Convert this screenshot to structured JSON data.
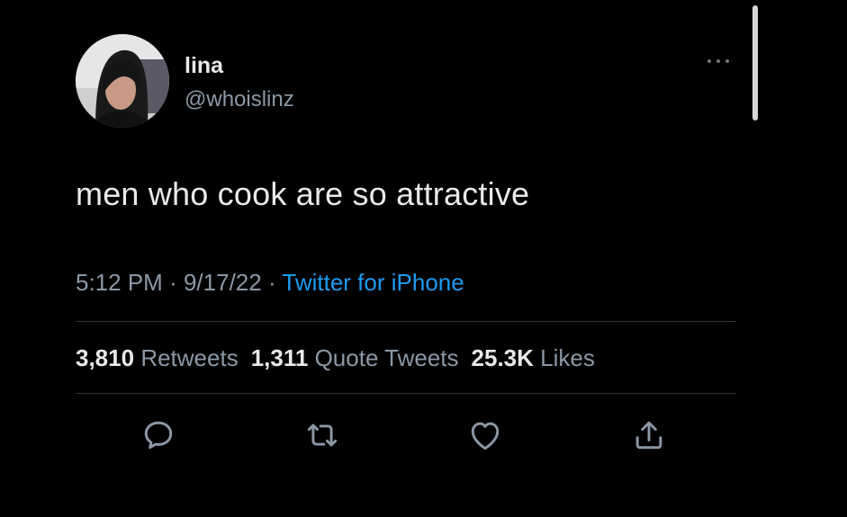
{
  "tweet": {
    "author_name": "lina",
    "author_handle": "@whoislinz",
    "text": "men who cook are so attractive",
    "time": "5:12 PM",
    "date": "9/17/22",
    "separator": "·",
    "source": "Twitter for iPhone"
  },
  "stats": {
    "retweets_count": "3,810",
    "retweets_label": "Retweets",
    "quotes_count": "1,311",
    "quotes_label": "Quote Tweets",
    "likes_count": "25.3K",
    "likes_label": "Likes"
  },
  "icons": {
    "more": "more-horizontal-icon",
    "reply": "reply-icon",
    "retweet": "retweet-icon",
    "like": "heart-icon",
    "share": "share-icon"
  },
  "colors": {
    "background": "#000000",
    "primary_text": "#e7e9ea",
    "secondary_text": "#8b98a5",
    "accent": "#1d9bf0",
    "divider": "#2f3336"
  }
}
